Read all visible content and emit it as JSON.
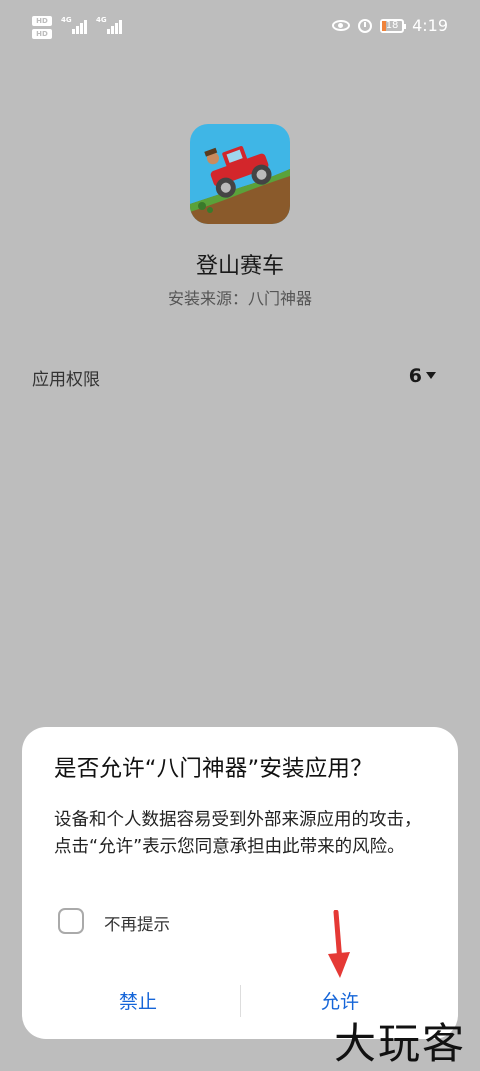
{
  "status_bar": {
    "left": [
      {
        "badge": "HD",
        "net": "4G"
      },
      {
        "badge": "HD",
        "net": "4G"
      }
    ],
    "battery_level": "18",
    "time": "4:19",
    "icons": [
      "eye-comfort-icon",
      "alarm-icon",
      "battery-icon"
    ],
    "battery_color": "#f0843c"
  },
  "app": {
    "name": "登山赛车",
    "source_label": "安装来源：",
    "source_value": "八门神器",
    "icon": "hill-climb-racing-app-icon"
  },
  "permissions": {
    "label": "应用权限",
    "count": "6"
  },
  "dialog": {
    "title": "是否允许“八门神器”安装应用？",
    "message": "设备和个人数据容易受到外部来源应用的攻击，点击“允许”表示您同意承担由此带来的风险。",
    "checkbox_label": "不再提示",
    "checkbox_checked": false,
    "deny_label": "禁止",
    "allow_label": "允许",
    "button_color": "#1565d8"
  },
  "overlay": {
    "arrow_color": "#e53935",
    "watermark": "大玩客"
  }
}
